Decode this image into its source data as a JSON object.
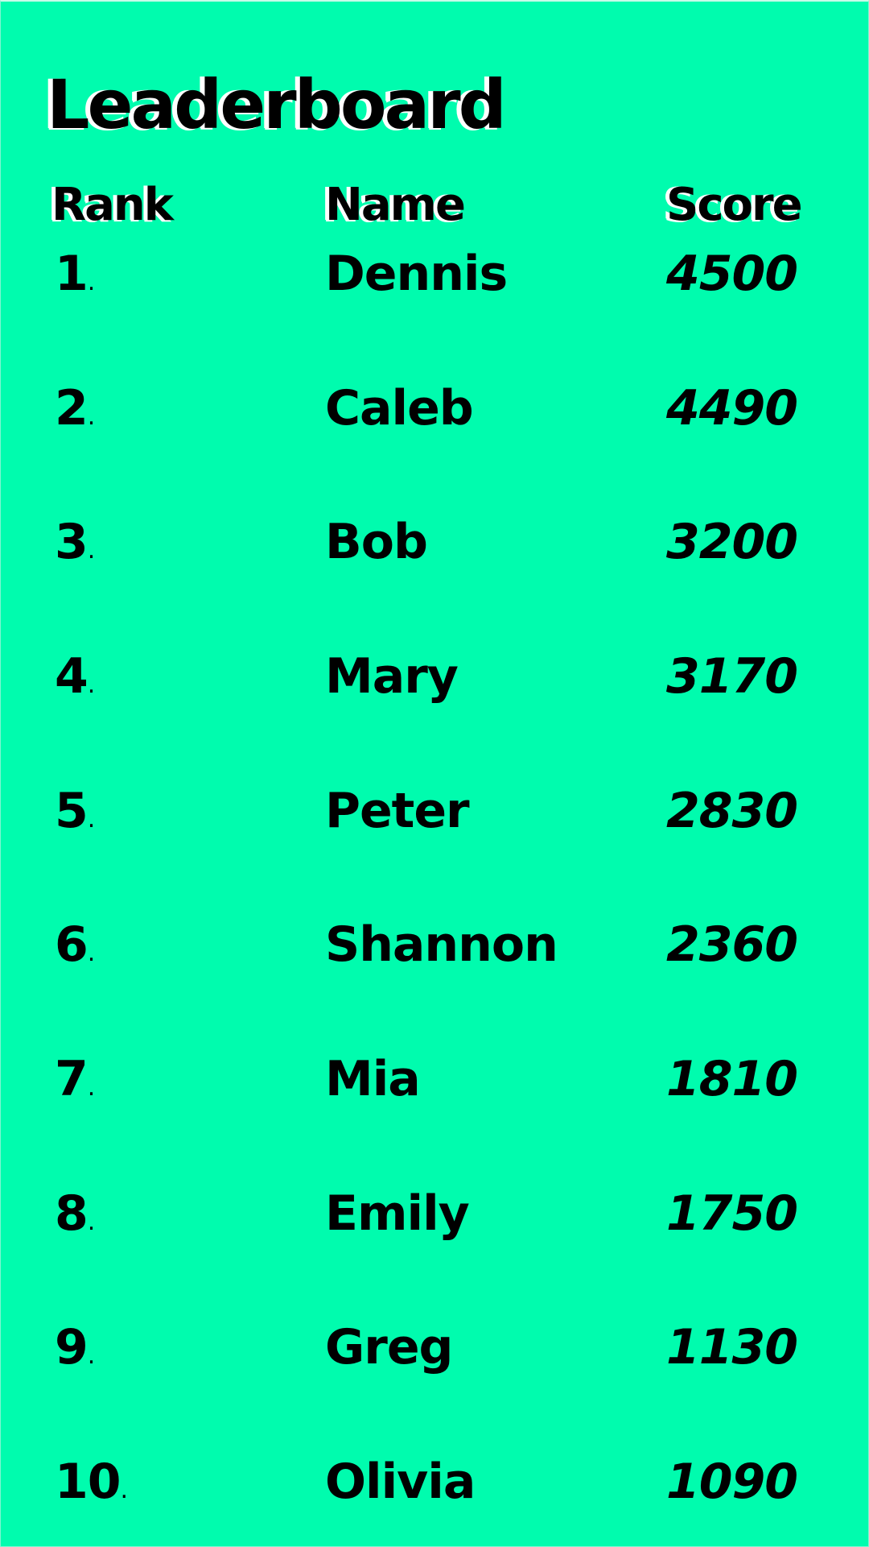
{
  "screen": {
    "title": "Leaderboard",
    "background_color": "#00FCAE",
    "text_color": "#000000",
    "shadow_color": "#ffffff"
  },
  "columns": {
    "rank": "Rank",
    "name": "Name",
    "score": "Score"
  },
  "entries": [
    {
      "rank": "1",
      "name": "Dennis",
      "score": "4500"
    },
    {
      "rank": "2",
      "name": "Caleb",
      "score": "4490"
    },
    {
      "rank": "3",
      "name": "Bob",
      "score": "3200"
    },
    {
      "rank": "4",
      "name": "Mary",
      "score": "3170"
    },
    {
      "rank": "5",
      "name": "Peter",
      "score": "2830"
    },
    {
      "rank": "6",
      "name": "Shannon",
      "score": "2360"
    },
    {
      "rank": "7",
      "name": "Mia",
      "score": "1810"
    },
    {
      "rank": "8",
      "name": "Emily",
      "score": "1750"
    },
    {
      "rank": "9",
      "name": "Greg",
      "score": "1130"
    },
    {
      "rank": "10",
      "name": "Olivia",
      "score": "1090"
    }
  ],
  "rank_suffix": "."
}
